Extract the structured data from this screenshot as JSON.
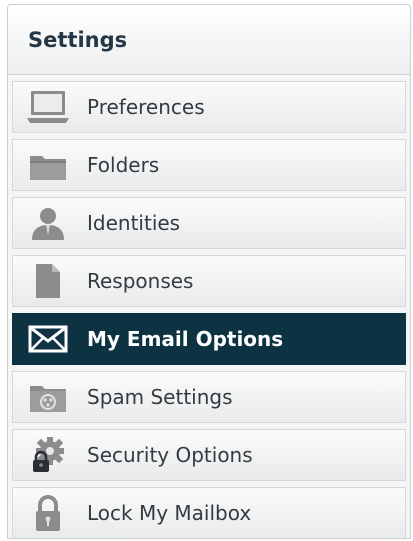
{
  "panel": {
    "title": "Settings"
  },
  "menu": {
    "items": [
      {
        "label": "Preferences",
        "icon": "laptop-icon",
        "active": false
      },
      {
        "label": "Folders",
        "icon": "folder-icon",
        "active": false
      },
      {
        "label": "Identities",
        "icon": "person-icon",
        "active": false
      },
      {
        "label": "Responses",
        "icon": "document-icon",
        "active": false
      },
      {
        "label": "My Email Options",
        "icon": "envelope-icon",
        "active": true
      },
      {
        "label": "Spam Settings",
        "icon": "spam-folder-icon",
        "active": false
      },
      {
        "label": "Security Options",
        "icon": "gear-lock-icon",
        "active": false
      },
      {
        "label": "Lock My Mailbox",
        "icon": "padlock-icon",
        "active": false
      }
    ]
  },
  "colors": {
    "active_background": "#0d3342",
    "icon_gray": "#8a8c8e",
    "title_text": "#233746"
  }
}
